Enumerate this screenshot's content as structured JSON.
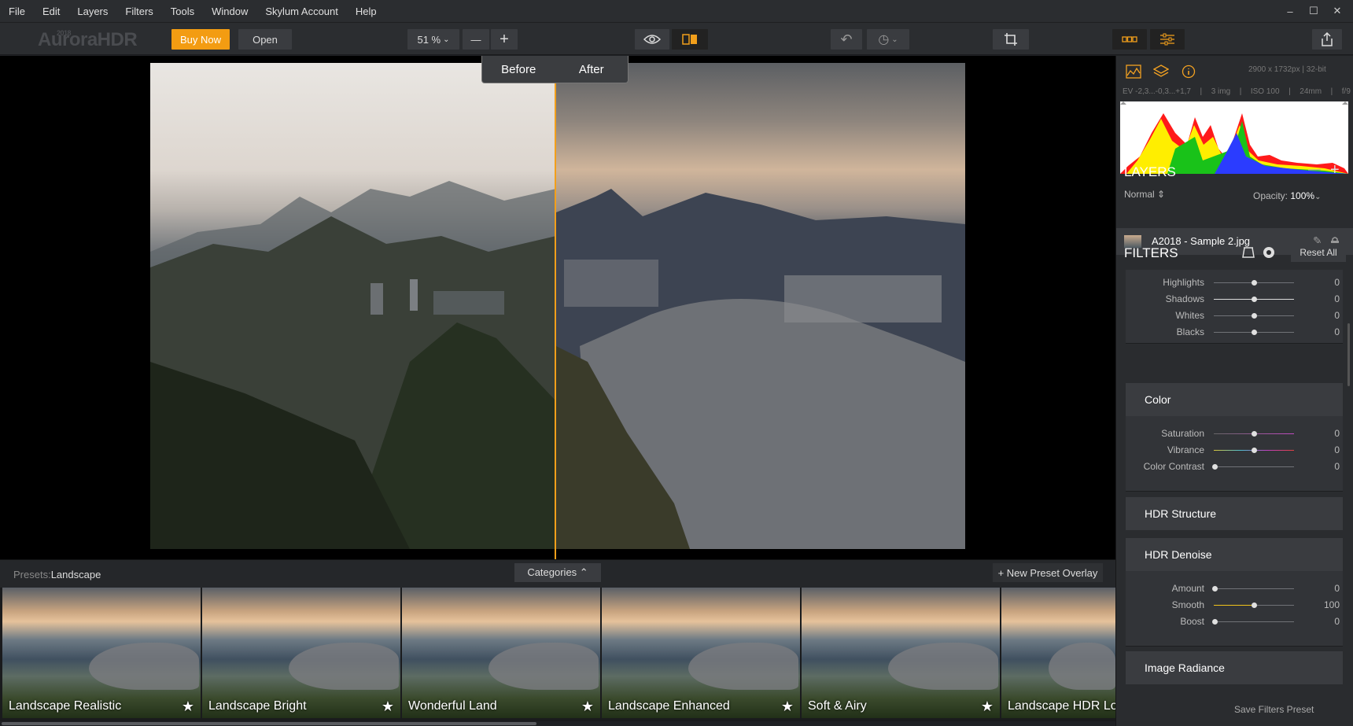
{
  "menu": [
    "File",
    "Edit",
    "Layers",
    "Filters",
    "Tools",
    "Window",
    "Skylum Account",
    "Help"
  ],
  "window_controls": [
    "–",
    "☐",
    "✕"
  ],
  "toolbar": {
    "logo": "AuroraHDR",
    "logo_year": "2018",
    "buy_now": "Buy Now",
    "open": "Open",
    "zoom": "51 %",
    "zoom_out": "—",
    "zoom_in": "+",
    "undo_icon": "↶",
    "history_icon": "◷"
  },
  "canvas": {
    "before_label": "Before",
    "after_label": "After",
    "split_color": "#f29f1b"
  },
  "presets": {
    "label": "Presets:",
    "category": "Landscape",
    "categories_button": "Categories ⌃",
    "new_overlay": "+ New Preset Overlay",
    "items": [
      {
        "name": "Landscape Realistic"
      },
      {
        "name": "Landscape Bright"
      },
      {
        "name": "Wonderful Land"
      },
      {
        "name": "Landscape Enhanced"
      },
      {
        "name": "Soft & Airy"
      },
      {
        "name": "Landscape HDR Loo"
      }
    ]
  },
  "panel": {
    "image_info": "2900 x 1732px | 32-bit",
    "exif": [
      "EV -2,3...-0,3...+1,7",
      "|",
      "3 img",
      "|",
      "ISO 100",
      "|",
      "24mm",
      "|",
      "f/9"
    ],
    "layers_title": "LAYERS",
    "blend_mode": "Normal",
    "opacity_label": "Opacity:",
    "opacity_value": "100%",
    "layer_name": "A2018 - Sample 2.jpg",
    "filters_title": "FILTERS",
    "reset_all": "Reset All",
    "tone_sliders": [
      {
        "label": "Highlights",
        "value": "0",
        "pos": 0.5
      },
      {
        "label": "Shadows",
        "value": "0",
        "pos": 0.5
      },
      {
        "label": "Whites",
        "value": "0",
        "pos": 0.5
      },
      {
        "label": "Blacks",
        "value": "0",
        "pos": 0.5
      }
    ],
    "color_title": "Color",
    "color_sliders": [
      {
        "label": "Saturation",
        "value": "0",
        "pos": 0.5
      },
      {
        "label": "Vibrance",
        "value": "0",
        "pos": 0.5
      },
      {
        "label": "Color Contrast",
        "value": "0",
        "pos": 0.0
      }
    ],
    "hdr_structure": "HDR Structure",
    "hdr_denoise": "HDR Denoise",
    "denoise_sliders": [
      {
        "label": "Amount",
        "value": "0",
        "pos": 0.0
      },
      {
        "label": "Smooth",
        "value": "100",
        "pos": 0.5
      },
      {
        "label": "Boost",
        "value": "0",
        "pos": 0.0
      }
    ],
    "image_radiance": "Image Radiance",
    "save_preset": "Save Filters Preset"
  }
}
